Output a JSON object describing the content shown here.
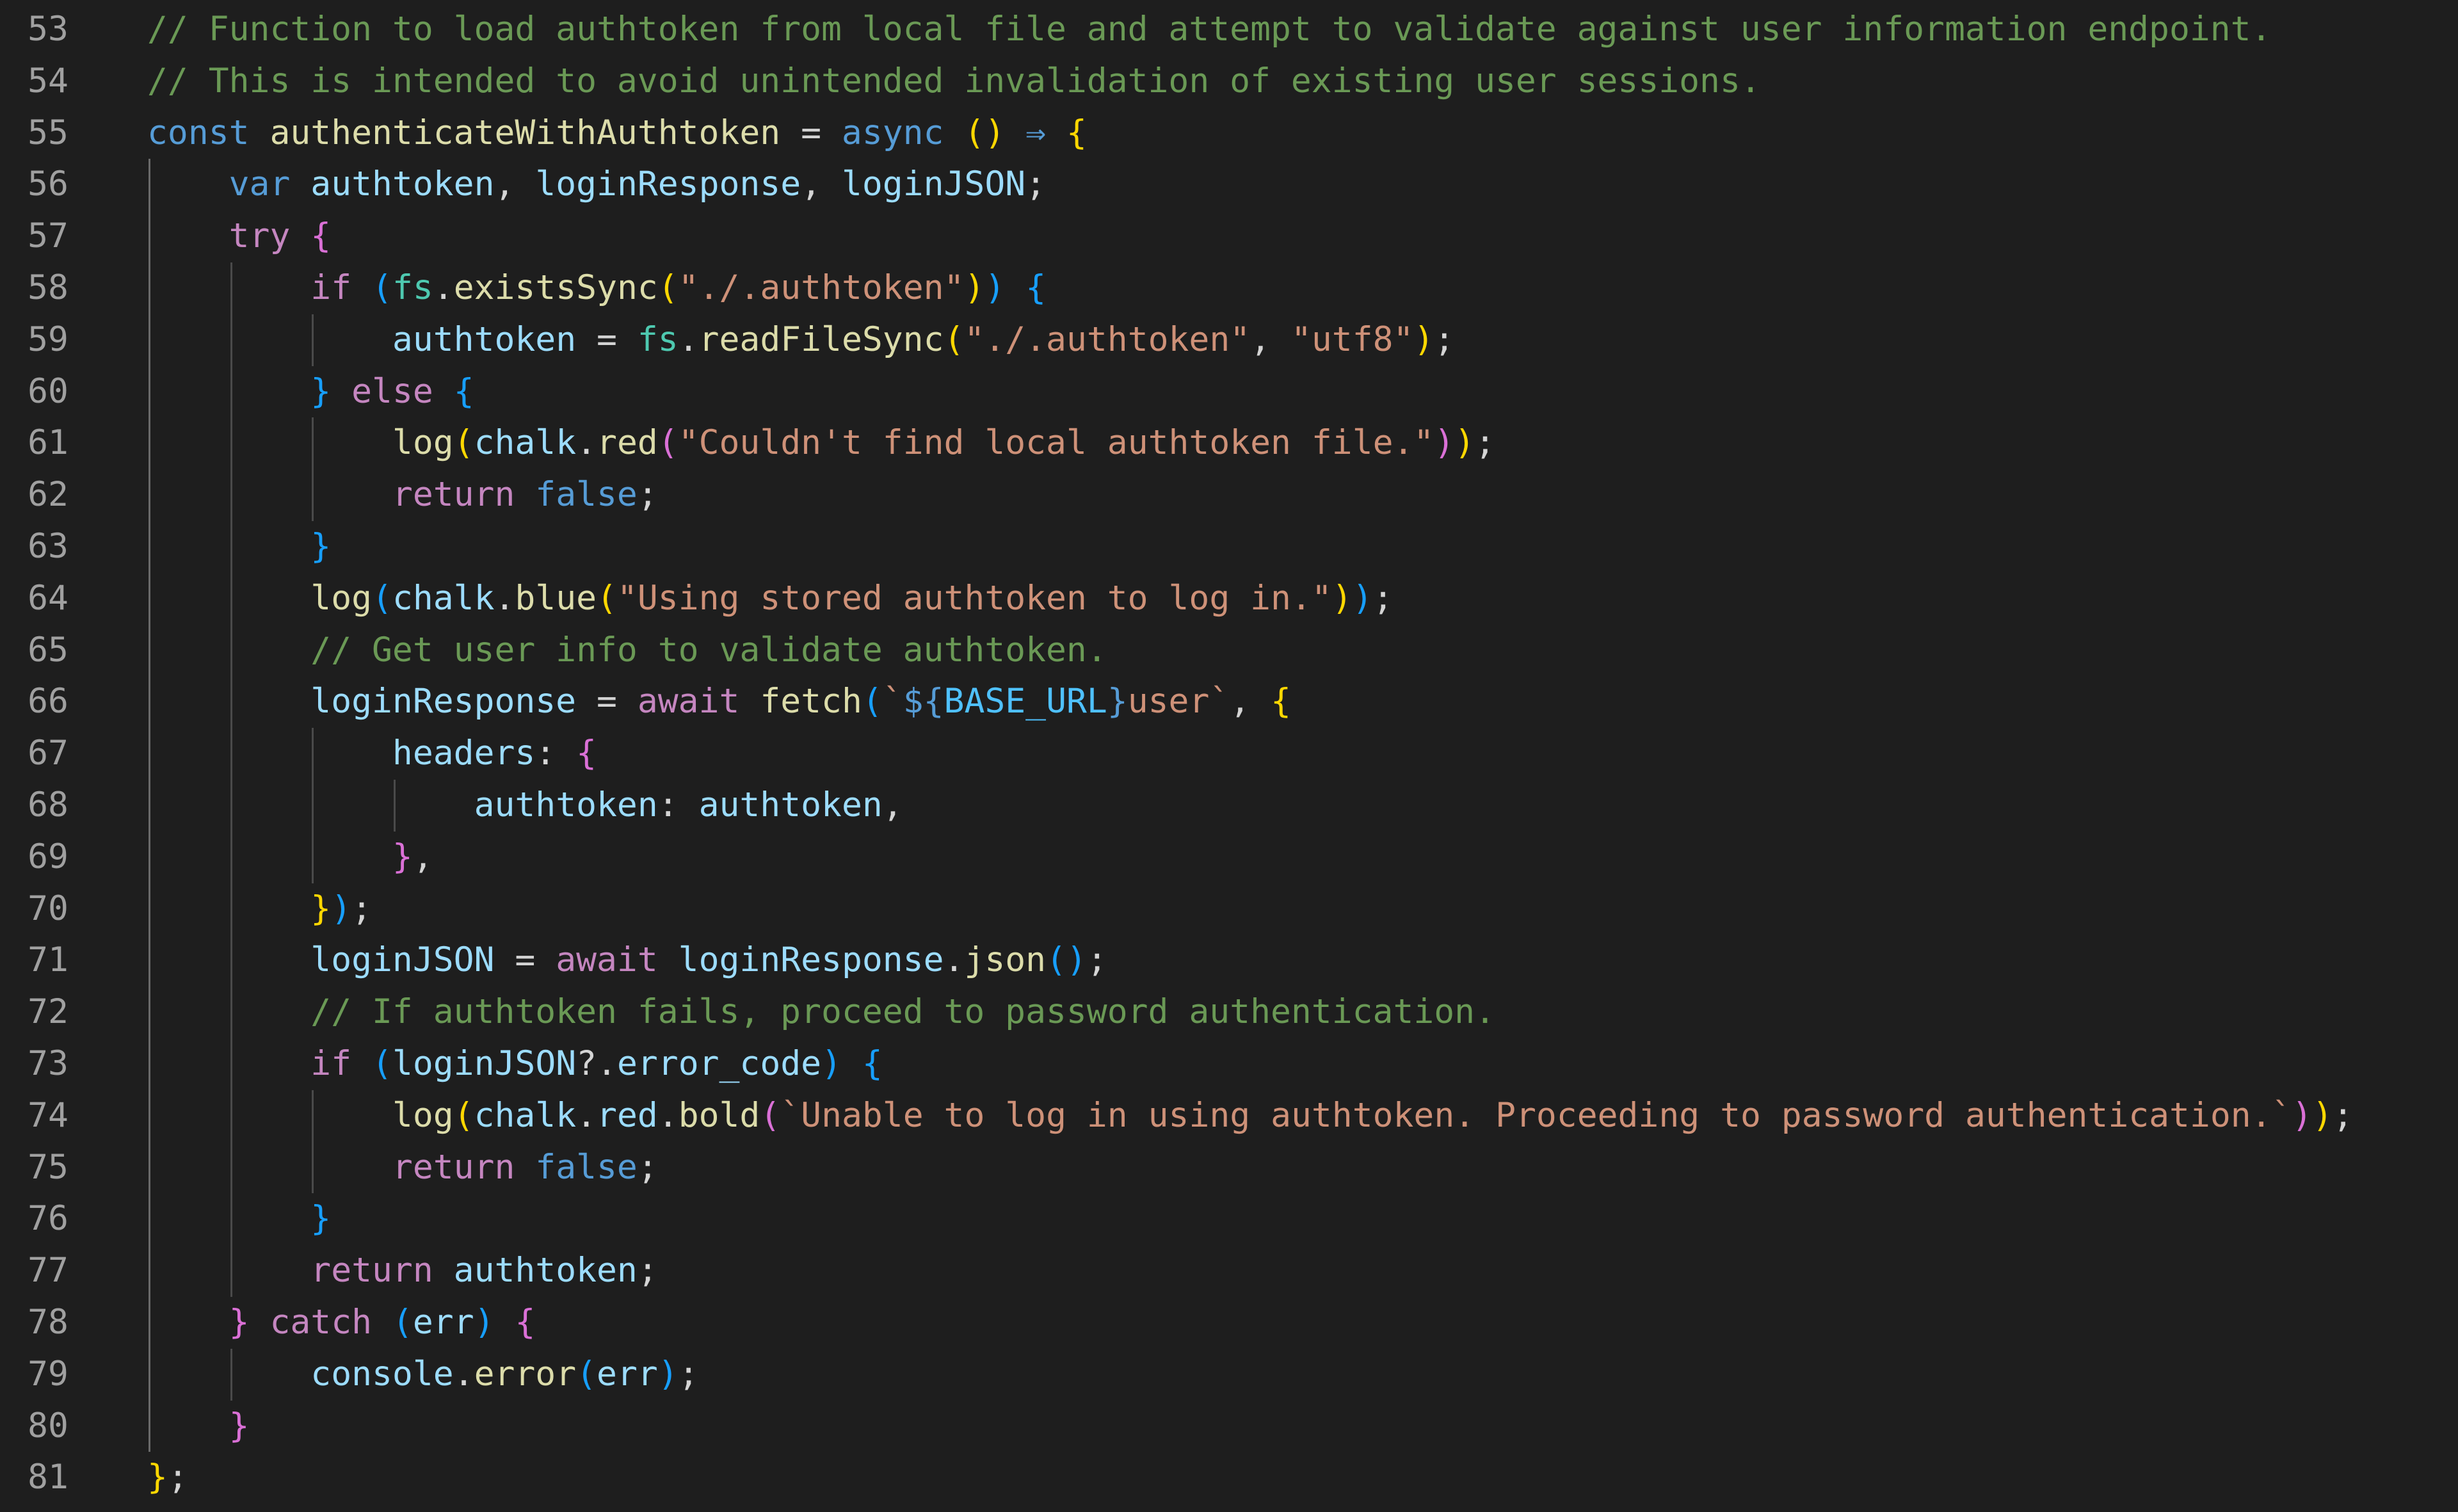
{
  "editor": {
    "language": "javascript",
    "first_line": 53,
    "last_line": 81,
    "lines": [
      {
        "n": "53",
        "indent": 0,
        "tokens": [
          [
            "t-comment",
            "// Function to load authtoken from local file and attempt to validate against user information endpoint."
          ]
        ]
      },
      {
        "n": "54",
        "indent": 0,
        "tokens": [
          [
            "t-comment",
            "// This is intended to avoid unintended invalidation of existing user sessions."
          ]
        ]
      },
      {
        "n": "55",
        "indent": 0,
        "tokens": [
          [
            "t-keyword",
            "const"
          ],
          [
            "t-punc",
            " "
          ],
          [
            "t-fn",
            "authenticateWithAuthtoken"
          ],
          [
            "t-op",
            " = "
          ],
          [
            "t-keyword",
            "async"
          ],
          [
            "t-punc",
            " "
          ],
          [
            "t-b1",
            "()"
          ],
          [
            "t-punc",
            " "
          ],
          [
            "t-arrow",
            "⇒"
          ],
          [
            "t-punc",
            " "
          ],
          [
            "t-b1",
            "{"
          ]
        ]
      },
      {
        "n": "56",
        "indent": 1,
        "tokens": [
          [
            "t-keyword",
            "var"
          ],
          [
            "t-punc",
            " "
          ],
          [
            "t-var",
            "authtoken"
          ],
          [
            "t-punc",
            ", "
          ],
          [
            "t-var",
            "loginResponse"
          ],
          [
            "t-punc",
            ", "
          ],
          [
            "t-var",
            "loginJSON"
          ],
          [
            "t-punc",
            ";"
          ]
        ]
      },
      {
        "n": "57",
        "indent": 1,
        "tokens": [
          [
            "t-control",
            "try"
          ],
          [
            "t-punc",
            " "
          ],
          [
            "t-b2",
            "{"
          ]
        ]
      },
      {
        "n": "58",
        "indent": 2,
        "tokens": [
          [
            "t-control",
            "if"
          ],
          [
            "t-punc",
            " "
          ],
          [
            "t-b3",
            "("
          ],
          [
            "t-obj",
            "fs"
          ],
          [
            "t-punc",
            "."
          ],
          [
            "t-fn",
            "existsSync"
          ],
          [
            "t-b1",
            "("
          ],
          [
            "t-string",
            "\"./.authtoken\""
          ],
          [
            "t-b1",
            ")"
          ],
          [
            "t-b3",
            ")"
          ],
          [
            "t-punc",
            " "
          ],
          [
            "t-b3",
            "{"
          ]
        ]
      },
      {
        "n": "59",
        "indent": 3,
        "tokens": [
          [
            "t-var",
            "authtoken"
          ],
          [
            "t-op",
            " = "
          ],
          [
            "t-obj",
            "fs"
          ],
          [
            "t-punc",
            "."
          ],
          [
            "t-fn",
            "readFileSync"
          ],
          [
            "t-b1",
            "("
          ],
          [
            "t-string",
            "\"./.authtoken\""
          ],
          [
            "t-punc",
            ", "
          ],
          [
            "t-string",
            "\"utf8\""
          ],
          [
            "t-b1",
            ")"
          ],
          [
            "t-punc",
            ";"
          ]
        ]
      },
      {
        "n": "60",
        "indent": 2,
        "tokens": [
          [
            "t-b3",
            "}"
          ],
          [
            "t-punc",
            " "
          ],
          [
            "t-control",
            "else"
          ],
          [
            "t-punc",
            " "
          ],
          [
            "t-b3",
            "{"
          ]
        ]
      },
      {
        "n": "61",
        "indent": 3,
        "tokens": [
          [
            "t-fn",
            "log"
          ],
          [
            "t-b1",
            "("
          ],
          [
            "t-var",
            "chalk"
          ],
          [
            "t-punc",
            "."
          ],
          [
            "t-fn",
            "red"
          ],
          [
            "t-b2",
            "("
          ],
          [
            "t-string",
            "\"Couldn't find local authtoken file.\""
          ],
          [
            "t-b2",
            ")"
          ],
          [
            "t-b1",
            ")"
          ],
          [
            "t-punc",
            ";"
          ]
        ]
      },
      {
        "n": "62",
        "indent": 3,
        "tokens": [
          [
            "t-control",
            "return"
          ],
          [
            "t-punc",
            " "
          ],
          [
            "t-keyword",
            "false"
          ],
          [
            "t-punc",
            ";"
          ]
        ]
      },
      {
        "n": "63",
        "indent": 2,
        "tokens": [
          [
            "t-b3",
            "}"
          ]
        ]
      },
      {
        "n": "64",
        "indent": 2,
        "tokens": [
          [
            "t-fn",
            "log"
          ],
          [
            "t-b3",
            "("
          ],
          [
            "t-var",
            "chalk"
          ],
          [
            "t-punc",
            "."
          ],
          [
            "t-fn",
            "blue"
          ],
          [
            "t-b1",
            "("
          ],
          [
            "t-string",
            "\"Using stored authtoken to log in.\""
          ],
          [
            "t-b1",
            ")"
          ],
          [
            "t-b3",
            ")"
          ],
          [
            "t-punc",
            ";"
          ]
        ]
      },
      {
        "n": "65",
        "indent": 2,
        "tokens": [
          [
            "t-comment",
            "// Get user info to validate authtoken."
          ]
        ]
      },
      {
        "n": "66",
        "indent": 2,
        "tokens": [
          [
            "t-var",
            "loginResponse"
          ],
          [
            "t-op",
            " = "
          ],
          [
            "t-control",
            "await"
          ],
          [
            "t-punc",
            " "
          ],
          [
            "t-fn",
            "fetch"
          ],
          [
            "t-b3",
            "("
          ],
          [
            "t-string",
            "`"
          ],
          [
            "t-keyword",
            "${"
          ],
          [
            "t-const",
            "BASE_URL"
          ],
          [
            "t-keyword",
            "}"
          ],
          [
            "t-string",
            "user`"
          ],
          [
            "t-punc",
            ", "
          ],
          [
            "t-b1",
            "{"
          ]
        ]
      },
      {
        "n": "67",
        "indent": 3,
        "tokens": [
          [
            "t-prop",
            "headers"
          ],
          [
            "t-punc",
            ": "
          ],
          [
            "t-b2",
            "{"
          ]
        ]
      },
      {
        "n": "68",
        "indent": 4,
        "tokens": [
          [
            "t-prop",
            "authtoken"
          ],
          [
            "t-punc",
            ": "
          ],
          [
            "t-var",
            "authtoken"
          ],
          [
            "t-punc",
            ","
          ]
        ]
      },
      {
        "n": "69",
        "indent": 3,
        "tokens": [
          [
            "t-b2",
            "}"
          ],
          [
            "t-punc",
            ","
          ]
        ]
      },
      {
        "n": "70",
        "indent": 2,
        "tokens": [
          [
            "t-b1",
            "}"
          ],
          [
            "t-b3",
            ")"
          ],
          [
            "t-punc",
            ";"
          ]
        ]
      },
      {
        "n": "71",
        "indent": 2,
        "tokens": [
          [
            "t-var",
            "loginJSON"
          ],
          [
            "t-op",
            " = "
          ],
          [
            "t-control",
            "await"
          ],
          [
            "t-punc",
            " "
          ],
          [
            "t-var",
            "loginResponse"
          ],
          [
            "t-punc",
            "."
          ],
          [
            "t-fn",
            "json"
          ],
          [
            "t-b3",
            "()"
          ],
          [
            "t-punc",
            ";"
          ]
        ]
      },
      {
        "n": "72",
        "indent": 2,
        "tokens": [
          [
            "t-comment",
            "// If authtoken fails, proceed to password authentication."
          ]
        ]
      },
      {
        "n": "73",
        "indent": 2,
        "tokens": [
          [
            "t-control",
            "if"
          ],
          [
            "t-punc",
            " "
          ],
          [
            "t-b3",
            "("
          ],
          [
            "t-var",
            "loginJSON"
          ],
          [
            "t-punc",
            "?."
          ],
          [
            "t-prop",
            "error_code"
          ],
          [
            "t-b3",
            ")"
          ],
          [
            "t-punc",
            " "
          ],
          [
            "t-b3",
            "{"
          ]
        ]
      },
      {
        "n": "74",
        "indent": 3,
        "tokens": [
          [
            "t-fn",
            "log"
          ],
          [
            "t-b1",
            "("
          ],
          [
            "t-var",
            "chalk"
          ],
          [
            "t-punc",
            "."
          ],
          [
            "t-var",
            "red"
          ],
          [
            "t-punc",
            "."
          ],
          [
            "t-fn",
            "bold"
          ],
          [
            "t-b2",
            "("
          ],
          [
            "t-string",
            "`Unable to log in using authtoken. Proceeding to password authentication.`"
          ],
          [
            "t-b2",
            ")"
          ],
          [
            "t-b1",
            ")"
          ],
          [
            "t-punc",
            ";"
          ]
        ]
      },
      {
        "n": "75",
        "indent": 3,
        "tokens": [
          [
            "t-control",
            "return"
          ],
          [
            "t-punc",
            " "
          ],
          [
            "t-keyword",
            "false"
          ],
          [
            "t-punc",
            ";"
          ]
        ]
      },
      {
        "n": "76",
        "indent": 2,
        "tokens": [
          [
            "t-b3",
            "}"
          ]
        ]
      },
      {
        "n": "77",
        "indent": 2,
        "tokens": [
          [
            "t-control",
            "return"
          ],
          [
            "t-punc",
            " "
          ],
          [
            "t-var",
            "authtoken"
          ],
          [
            "t-punc",
            ";"
          ]
        ]
      },
      {
        "n": "78",
        "indent": 1,
        "tokens": [
          [
            "t-b2",
            "}"
          ],
          [
            "t-punc",
            " "
          ],
          [
            "t-control",
            "catch"
          ],
          [
            "t-punc",
            " "
          ],
          [
            "t-b3",
            "("
          ],
          [
            "t-var",
            "err"
          ],
          [
            "t-b3",
            ")"
          ],
          [
            "t-punc",
            " "
          ],
          [
            "t-b2",
            "{"
          ]
        ]
      },
      {
        "n": "79",
        "indent": 2,
        "tokens": [
          [
            "t-var",
            "console"
          ],
          [
            "t-punc",
            "."
          ],
          [
            "t-fn",
            "error"
          ],
          [
            "t-b3",
            "("
          ],
          [
            "t-var",
            "err"
          ],
          [
            "t-b3",
            ")"
          ],
          [
            "t-punc",
            ";"
          ]
        ]
      },
      {
        "n": "80",
        "indent": 1,
        "tokens": [
          [
            "t-b2",
            "}"
          ]
        ]
      },
      {
        "n": "81",
        "indent": 0,
        "tokens": [
          [
            "t-b1",
            "}"
          ],
          [
            "t-punc",
            ";"
          ]
        ]
      }
    ]
  },
  "colors": {
    "background": "#1e1e1e",
    "line_number": "#a0a0a0",
    "comment": "#6a9955",
    "keyword": "#569cd6",
    "control": "#c586c0",
    "function": "#dcdcaa",
    "variable": "#9cdcfe",
    "string": "#ce9178",
    "bracket_1": "#ffd700",
    "bracket_2": "#da70d6",
    "bracket_3": "#179fff"
  }
}
